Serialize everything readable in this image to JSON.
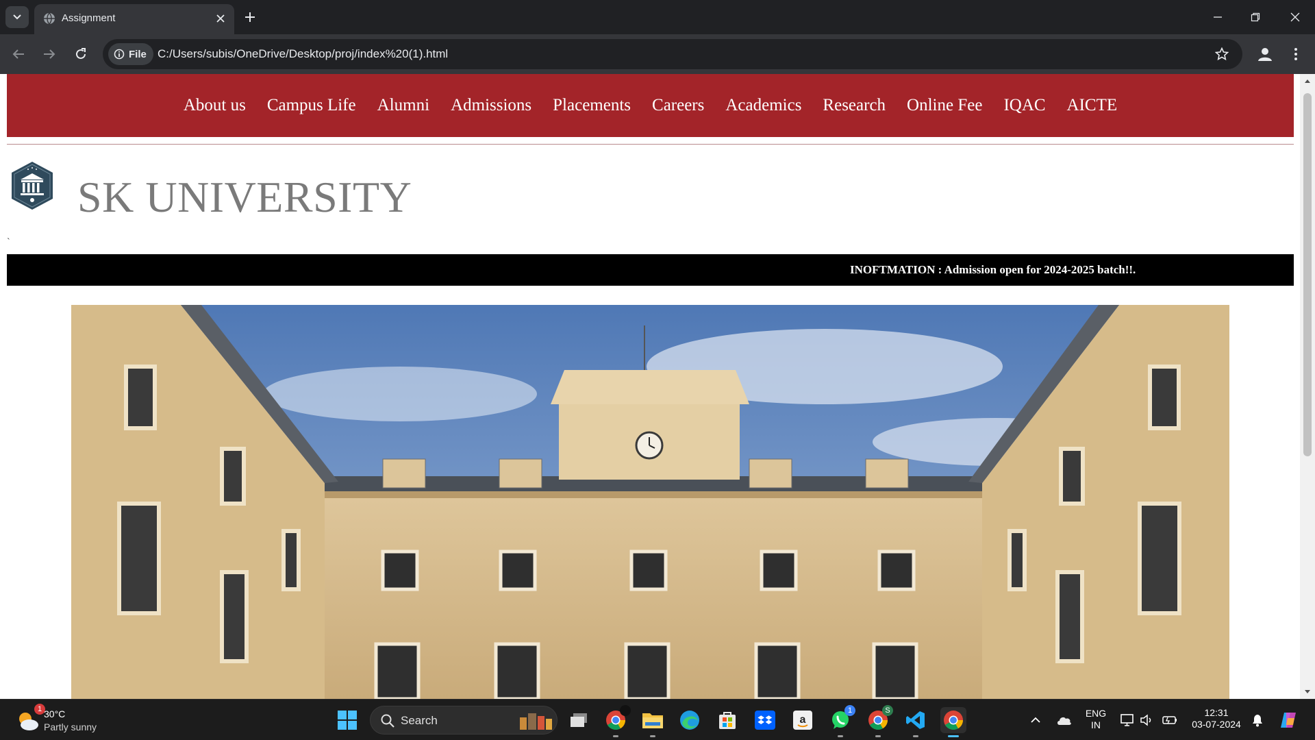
{
  "browser": {
    "tab_title": "Assignment",
    "chip_label": "File",
    "url": "C:/Users/subis/OneDrive/Desktop/proj/index%20(1).html"
  },
  "site": {
    "nav": [
      "About us",
      "Campus Life",
      "Alumni",
      "Admissions",
      "Placements",
      "Careers",
      "Academics",
      "Research",
      "Online Fee",
      "IQAC",
      "AICTE"
    ],
    "brand": "SK UNIVERSITY",
    "tick_mark": "`",
    "marquee": "INOFTMATION : Admission open for 2024-2025 batch!!.",
    "colors": {
      "nav_bg": "#a32429",
      "marquee_bg": "#000000",
      "brand_text": "#7a7a7a"
    }
  },
  "taskbar": {
    "weather_badge": "1",
    "temperature": "30°C",
    "weather": "Partly sunny",
    "search_label": "Search",
    "whatsapp_badge": "1",
    "chrome_profile_letter": "S",
    "lang_top": "ENG",
    "lang_bottom": "IN",
    "time": "12:31",
    "date": "03-07-2024",
    "accent": "#4cc2ff"
  }
}
